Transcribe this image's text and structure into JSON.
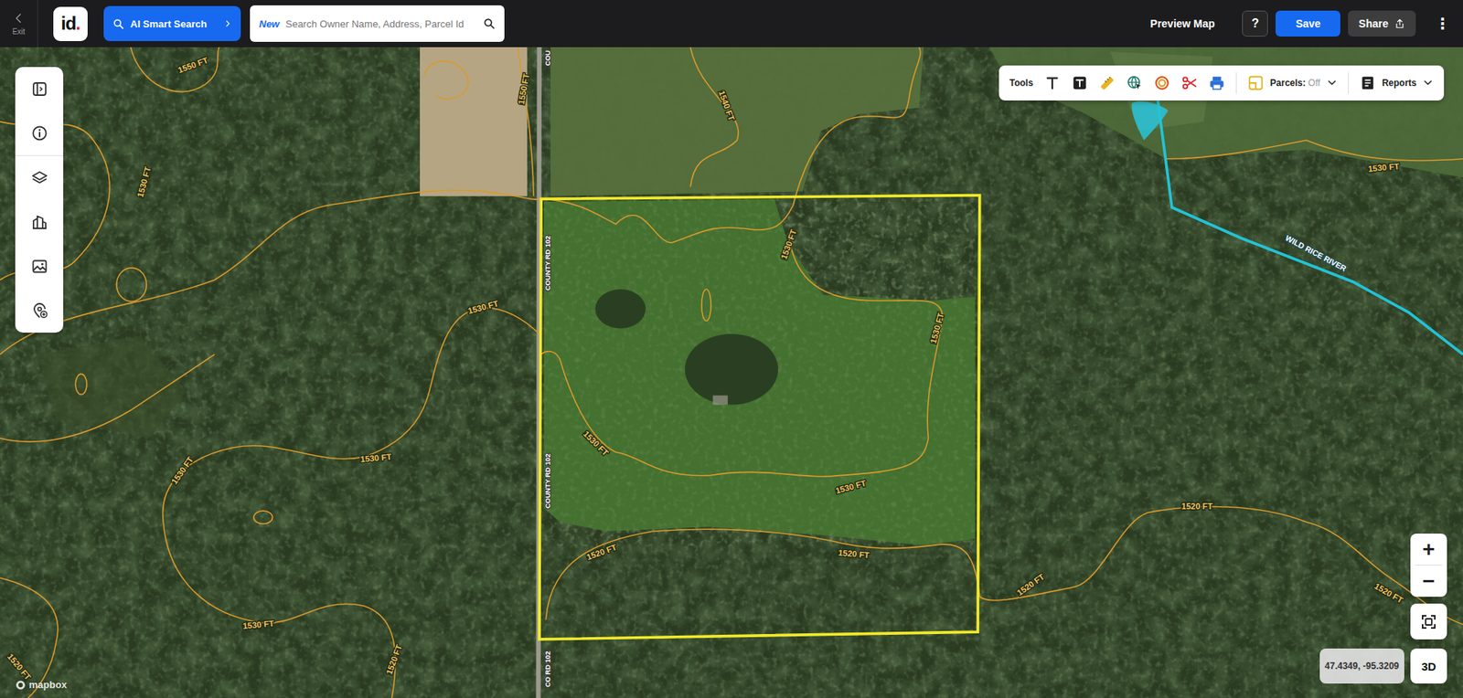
{
  "header": {
    "exit_label": "Exit",
    "logo": {
      "text": "id",
      "dot": "."
    },
    "ai_search": "AI Smart Search",
    "search": {
      "badge": "New",
      "placeholder": "Search Owner Name, Address, Parcel Id"
    },
    "preview": "Preview Map",
    "help": "?",
    "save": "Save",
    "share": "Share",
    "more": "⋮"
  },
  "toolbar": {
    "label": "Tools",
    "parcels": {
      "label": "Parcels:",
      "value": "Off"
    },
    "reports": "Reports"
  },
  "map": {
    "contour_labels": [
      "1550 FT",
      "1550 FT",
      "1540 FT",
      "1530 FT",
      "1530 FT",
      "1530 FT",
      "1530 FT",
      "1530 FT",
      "1530 FT",
      "1530 FT",
      "1530 FT",
      "1530 FT",
      "1520 FT",
      "1520 FT",
      "1520 FT",
      "1520 FT",
      "1520 FT",
      "1530 FT",
      "1520 FT",
      "1520 FT"
    ],
    "road_labels": [
      "COU",
      "COUNTY RD 102",
      "COUNTY RD 102",
      "CO RD 102"
    ],
    "river_label": "WILD RICE RIVER",
    "coordinates": "47.4349, -95.3209",
    "zoom_in": "+",
    "zoom_out": "−",
    "view_3d": "3D",
    "attribution": "mapbox"
  }
}
